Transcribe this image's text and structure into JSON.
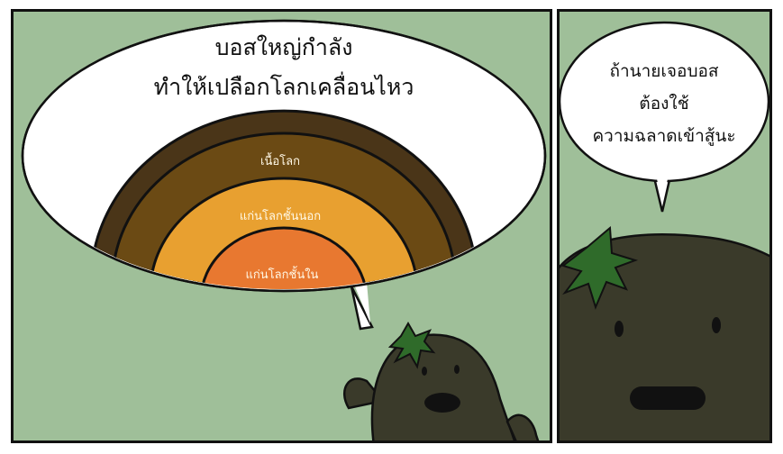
{
  "panels": {
    "left": {
      "speech_line1": "บอสใหญ่กำลัง",
      "speech_line2": "ทำให้เปลือกโลกเคลื่อนไหว",
      "layers": {
        "crust": "เนื้อโลก",
        "outer_core": "แก่นโลกชั้นนอก",
        "inner_core": "แก่นโลกชั้นใน"
      }
    },
    "right": {
      "speech_line1": "ถ้านายเจอบอส",
      "speech_line2": "ต้องใช้",
      "speech_line3": "ความฉลาดเข้าสู้นะ"
    }
  },
  "colors": {
    "background": "#9fbf99",
    "outer_layer": "#4a3518",
    "crust": "#6b4a14",
    "outer_core": "#e8a030",
    "inner_core": "#e87830",
    "character": "#3a3a2a",
    "leaf": "#2f6b2a"
  }
}
